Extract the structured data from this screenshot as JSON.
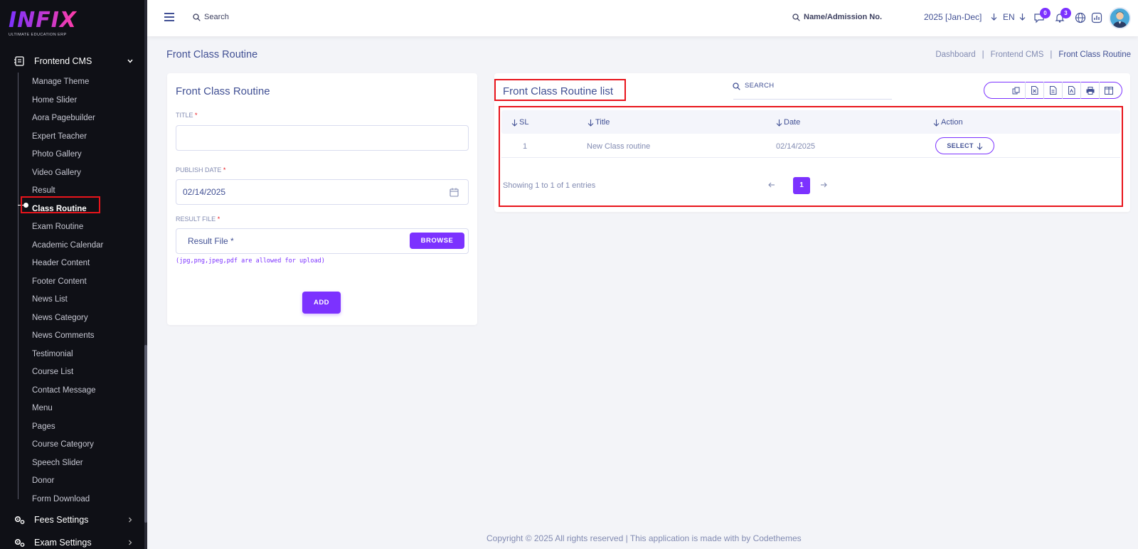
{
  "brand": {
    "logo_text": "INFIX",
    "logo_subtitle": "ULTIMATE EDUCATION ERP"
  },
  "sidebar": {
    "group_open": {
      "label": "Frontend CMS",
      "icon": "cms-icon"
    },
    "items": [
      {
        "label": "Manage Theme"
      },
      {
        "label": "Home Slider"
      },
      {
        "label": "Aora Pagebuilder"
      },
      {
        "label": "Expert Teacher"
      },
      {
        "label": "Photo Gallery"
      },
      {
        "label": "Video Gallery"
      },
      {
        "label": "Result"
      },
      {
        "label": "Class Routine",
        "active": true
      },
      {
        "label": "Exam Routine"
      },
      {
        "label": "Academic Calendar"
      },
      {
        "label": "Header Content"
      },
      {
        "label": "Footer Content"
      },
      {
        "label": "News List"
      },
      {
        "label": "News Category"
      },
      {
        "label": "News Comments"
      },
      {
        "label": "Testimonial"
      },
      {
        "label": "Course List"
      },
      {
        "label": "Contact Message"
      },
      {
        "label": "Menu"
      },
      {
        "label": "Pages"
      },
      {
        "label": "Course Category"
      },
      {
        "label": "Speech Slider"
      },
      {
        "label": "Donor"
      },
      {
        "label": "Form Download"
      }
    ],
    "groups_collapsed": [
      {
        "label": "Fees Settings",
        "icon": "gears-icon"
      },
      {
        "label": "Exam Settings",
        "icon": "gears-icon"
      }
    ]
  },
  "header": {
    "search_label": "Search",
    "student_search_label": "Name/Admission No.",
    "session": "2025 [Jan-Dec]",
    "language": "EN",
    "message_count": "0",
    "notification_count": "3"
  },
  "page": {
    "title": "Front Class Routine",
    "breadcrumbs": [
      "Dashboard",
      "Frontend CMS",
      "Front Class Routine"
    ]
  },
  "form": {
    "title": "Front Class Routine",
    "title_label": "TITLE",
    "publish_date_label": "PUBLISH DATE",
    "publish_date_value": "02/14/2025",
    "result_file_label": "RESULT FILE",
    "result_file_placeholder": "Result File *",
    "browse_label": "BROWSE",
    "hint": "(jpg,png,jpeg,pdf are allowed for upload)",
    "add_label": "ADD",
    "required_mark": "*"
  },
  "list": {
    "title": "Front Class Routine list",
    "search_label": "SEARCH",
    "export_icons": [
      "copy-icon",
      "excel-icon",
      "csv-icon",
      "pdf-icon",
      "print-icon",
      "columns-icon"
    ],
    "columns": [
      "SL",
      "Title",
      "Date",
      "Action"
    ],
    "rows": [
      {
        "sl": "1",
        "title": "New Class routine",
        "date": "02/14/2025",
        "action": "SELECT"
      }
    ],
    "showing": "Showing 1 to 1 of 1 entries",
    "current_page": "1"
  },
  "footer": {
    "text": "Copyright © 2025 All rights reserved | This application is made with by Codethemes"
  },
  "colors": {
    "accent": "#7c32ff",
    "highlight": "#e8141b",
    "sidebar_bg": "#0f1016",
    "text": "#415094"
  }
}
